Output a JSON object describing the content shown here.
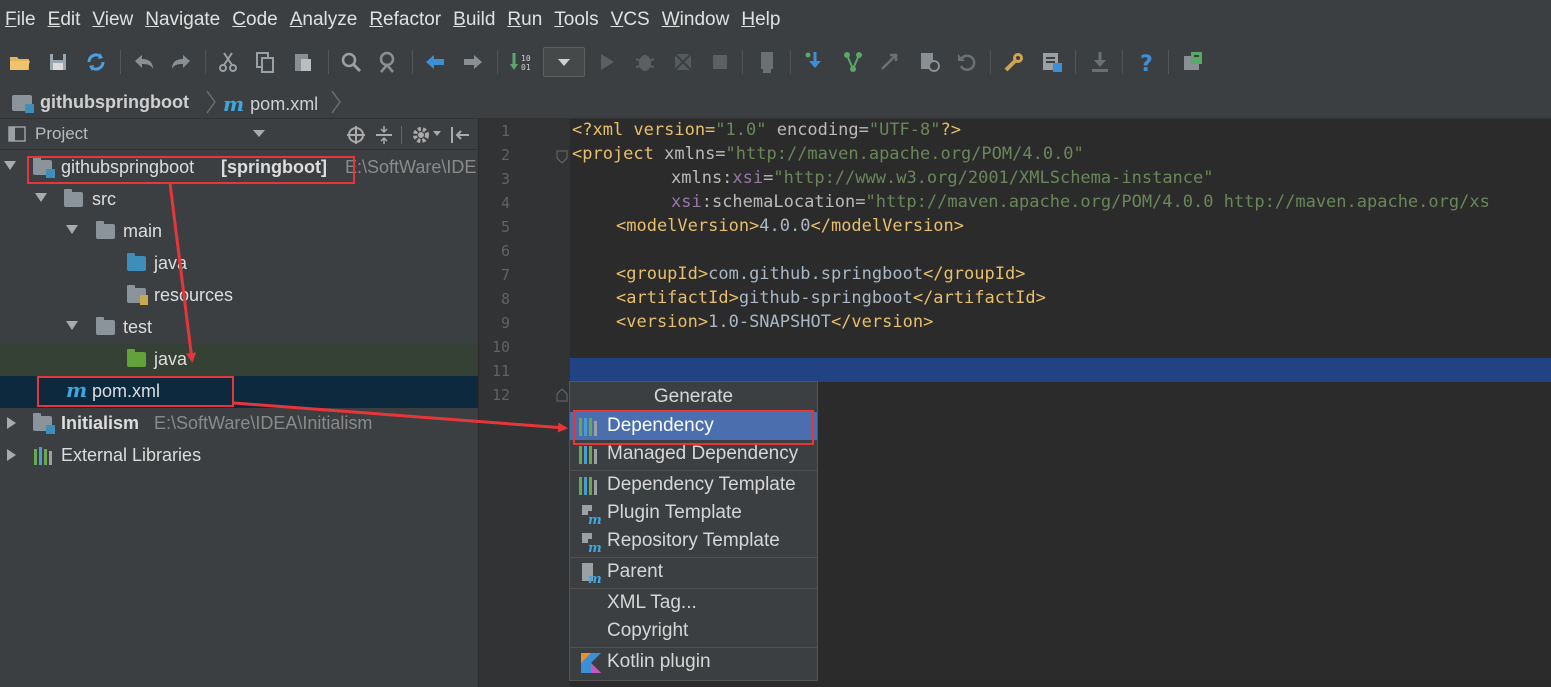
{
  "menu": [
    "File",
    "Edit",
    "View",
    "Navigate",
    "Code",
    "Analyze",
    "Refactor",
    "Build",
    "Run",
    "Tools",
    "VCS",
    "Window",
    "Help"
  ],
  "breadcrumb": {
    "project": "githubspringboot",
    "file": "pom.xml"
  },
  "project_panel": {
    "title": "Project",
    "tree": {
      "root_label": "githubspringboot",
      "root_module": "[springboot]",
      "root_path": "E:\\SoftWare\\IDE",
      "src": "src",
      "main": "main",
      "main_java": "java",
      "resources": "resources",
      "test": "test",
      "test_java": "java",
      "pom": "pom.xml",
      "initialism": "Initialism",
      "initialism_path": "E:\\SoftWare\\IDEA\\Initialism",
      "external": "External Libraries"
    }
  },
  "editor": {
    "line_numbers": [
      "1",
      "2",
      "3",
      "4",
      "5",
      "6",
      "7",
      "8",
      "9",
      "10",
      "11",
      "12"
    ],
    "lines": {
      "l1": {
        "a": "<?xml version=",
        "b": "\"1.0\"",
        "c": " encoding=",
        "d": "\"UTF-8\"",
        "e": "?>"
      },
      "l2": {
        "a": "<project ",
        "b": "xmlns=",
        "c": "\"http://maven.apache.org/POM/4.0.0\""
      },
      "l3": {
        "a": "xmlns:",
        "b": "xsi",
        "c": "=",
        "d": "\"http://www.w3.org/2001/XMLSchema-instance\""
      },
      "l4": {
        "a": "xsi",
        "b": ":schemaLocation=",
        "c": "\"http://maven.apache.org/POM/4.0.0 http://maven.apache.org/xs"
      },
      "l5": {
        "a": "<modelVersion>",
        "b": "4.0.0",
        "c": "</modelVersion>"
      },
      "l7": {
        "a": "<groupId>",
        "b": "com.github.springboot",
        "c": "</groupId>"
      },
      "l8": {
        "a": "<artifactId>",
        "b": "github-springboot",
        "c": "</artifactId>"
      },
      "l9": {
        "a": "<version>",
        "b": "1.0-SNAPSHOT",
        "c": "</version>"
      }
    }
  },
  "generate_popup": {
    "title": "Generate",
    "items": [
      "Dependency",
      "Managed Dependency",
      "Dependency Template",
      "Plugin Template",
      "Repository Template",
      "Parent",
      "XML Tag...",
      "Copyright",
      "Kotlin plugin"
    ],
    "selected": "Dependency"
  },
  "colors": {
    "annotation": "#e6363a",
    "selection": "#4b6eaf",
    "caret_line": "#214283"
  }
}
